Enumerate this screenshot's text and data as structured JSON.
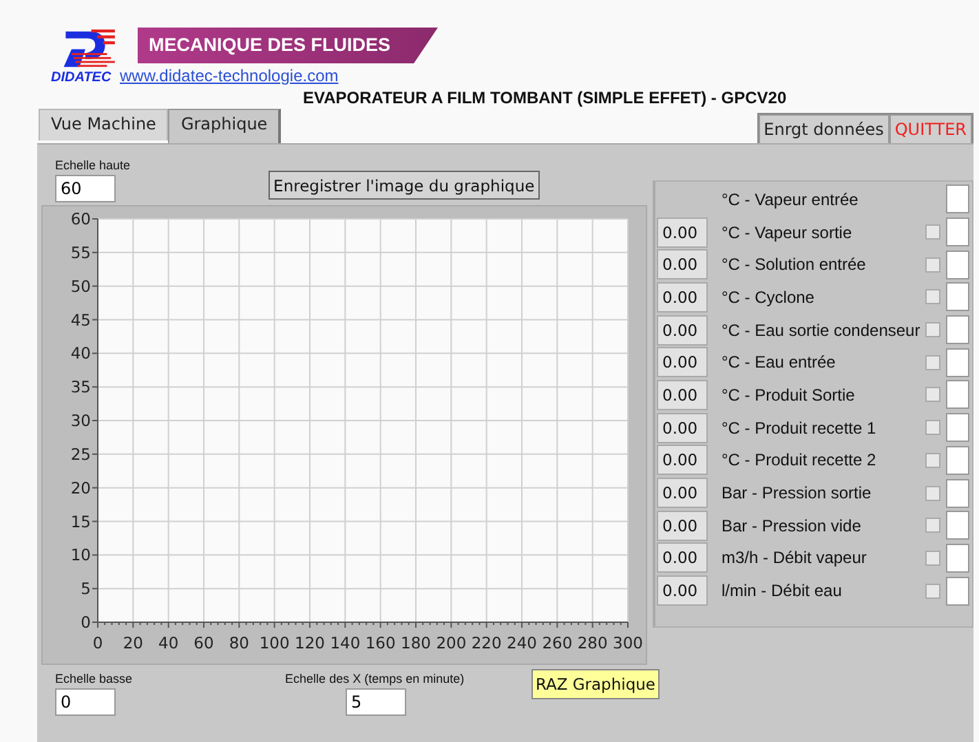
{
  "header": {
    "brand": "DIDATEC",
    "banner": "MECANIQUE DES FLUIDES",
    "url": "www.didatec-technologie.com",
    "title": "EVAPORATEUR A FILM TOMBANT (SIMPLE EFFET) - GPCV20"
  },
  "tabs": [
    {
      "label": "Vue Machine",
      "selected": false
    },
    {
      "label": "Graphique",
      "selected": true
    }
  ],
  "buttons": [
    {
      "label": "Enrgt données",
      "kind": "normal"
    },
    {
      "label": "QUITTER",
      "kind": "quit"
    }
  ],
  "graph": {
    "scale_high": {
      "label": "Echelle haute",
      "value": "60"
    },
    "save_button": "Enregistrer l'image du graphique",
    "chart_data": {
      "type": "line",
      "grid": true,
      "xlim": [
        0,
        300
      ],
      "ylim": [
        0,
        60
      ],
      "xticks": [
        0,
        20,
        40,
        60,
        80,
        100,
        120,
        140,
        160,
        180,
        200,
        220,
        240,
        260,
        280,
        300
      ],
      "yticks": [
        0,
        5,
        10,
        15,
        20,
        25,
        30,
        35,
        40,
        45,
        50,
        55,
        60
      ]
    },
    "scale_low": {
      "label": "Echelle basse",
      "value": "0"
    },
    "x_scale": {
      "label": "Echelle des X (temps en minute)",
      "value": "5"
    },
    "reset_button": "RAZ Graphique"
  },
  "legend": [
    {
      "label": "°C - Vapeur entrée"
    },
    {
      "value": "0.00",
      "label": "°C - Vapeur sortie",
      "checked": false
    },
    {
      "value": "0.00",
      "label": "°C - Solution entrée",
      "checked": false
    },
    {
      "value": "0.00",
      "label": "°C - Cyclone",
      "checked": false
    },
    {
      "value": "0.00",
      "label": "°C - Eau sortie condenseur",
      "checked": false
    },
    {
      "value": "0.00",
      "label": "°C - Eau entrée",
      "checked": false
    },
    {
      "value": "0.00",
      "label": "°C - Produit Sortie",
      "checked": false
    },
    {
      "value": "0.00",
      "label": "°C - Produit recette 1",
      "checked": false
    },
    {
      "value": "0.00",
      "label": "°C - Produit recette 2",
      "checked": false
    },
    {
      "value": "0.00",
      "label": "Bar - Pression sortie",
      "checked": false
    },
    {
      "value": "0.00",
      "label": "Bar - Pression vide",
      "checked": false
    },
    {
      "value": "0.00",
      "label": "m3/h - Débit vapeur",
      "checked": false
    },
    {
      "value": "0.00",
      "label": "l/min - Débit eau",
      "checked": false
    }
  ]
}
